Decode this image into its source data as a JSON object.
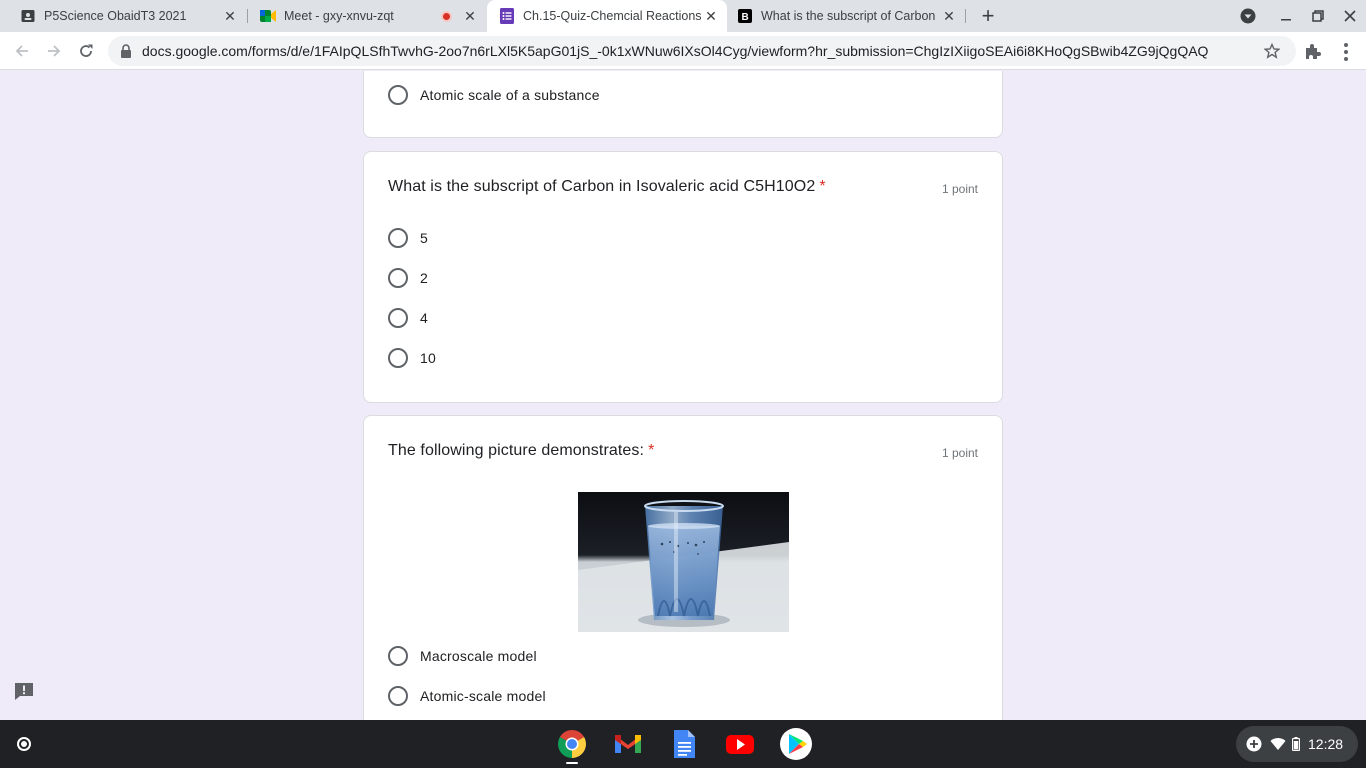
{
  "browser": {
    "tabs": [
      {
        "title": "P5Science ObaidT3 2021",
        "icon": "classroom-icon",
        "active": false
      },
      {
        "title": "Meet - gxy-xnvu-zqt",
        "icon": "meet-icon",
        "active": false,
        "recording": true
      },
      {
        "title": "Ch.15-Quiz-Chemcial Reactions",
        "icon": "forms-icon",
        "active": true
      },
      {
        "title": "What is the subscript of Carbon",
        "icon": "brainly-icon",
        "active": false
      }
    ],
    "url": "docs.google.com/forms/d/e/1FAIpQLSfhTwvhG-2oo7n6rLXl5K5apG01jS_-0k1xWNuw6IXsOl4Cyg/viewform?hr_submission=ChgIzIXiigoSEAi6i8KHoQgSBwib4ZG9jQgQAQ"
  },
  "form": {
    "prev_option": "Atomic scale of a substance",
    "question1": {
      "title": "What is the subscript of Carbon in Isovaleric acid C5H10O2",
      "required_mark": "*",
      "points": "1 point",
      "options": [
        "5",
        "2",
        "4",
        "10"
      ]
    },
    "question2": {
      "title": "The following picture demonstrates:",
      "required_mark": "*",
      "points": "1 point",
      "image": "glass-of-sparkling-water",
      "options": [
        "Macroscale model",
        "Atomic-scale model"
      ]
    }
  },
  "shelf": {
    "time": "12:28",
    "apps": [
      "chrome-icon",
      "gmail-icon",
      "docs-icon",
      "youtube-icon",
      "play-store-icon"
    ]
  },
  "colors": {
    "form_background": "#f0ebf8",
    "required": "#d93025",
    "forms_purple": "#673ab7"
  }
}
